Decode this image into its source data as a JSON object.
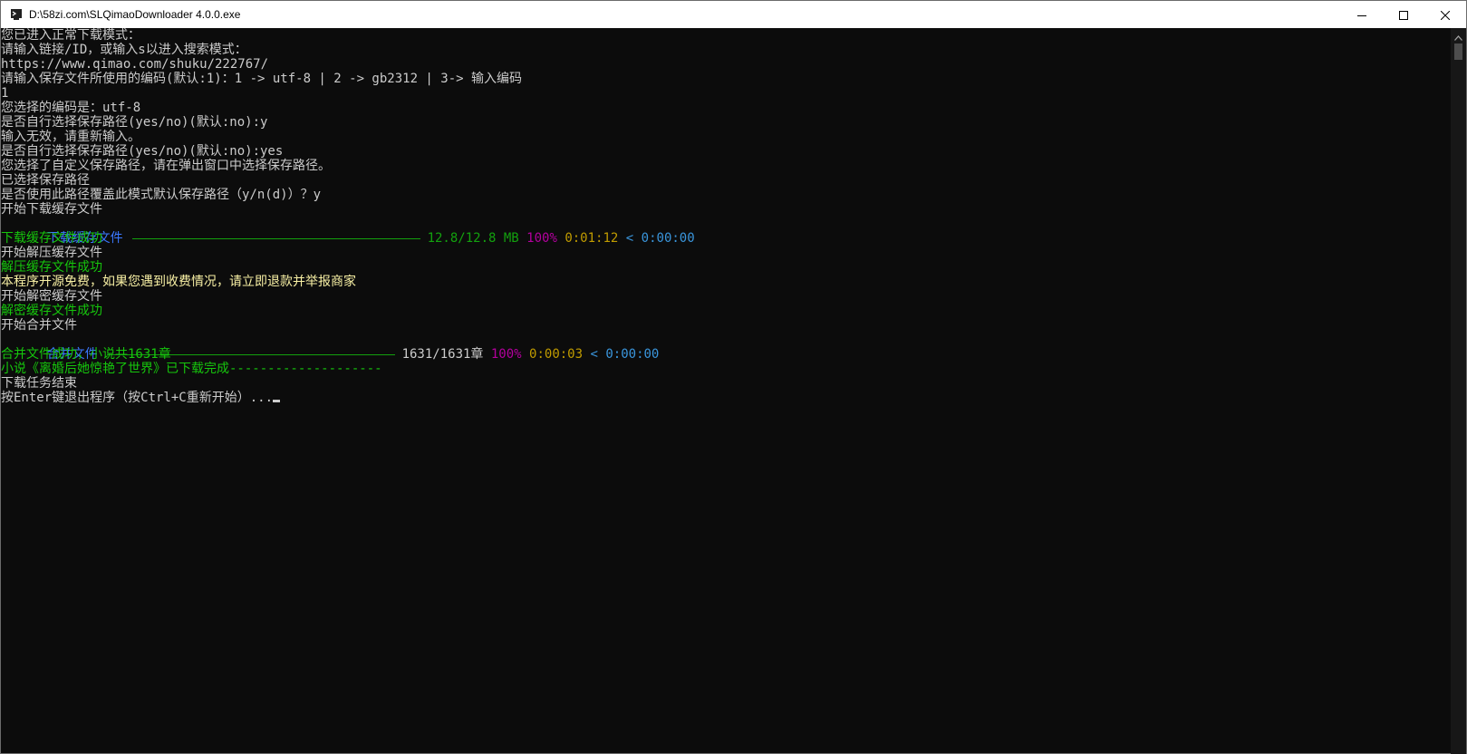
{
  "window": {
    "title": "D:\\58zi.com\\SLQimaoDownloader 4.0.0.exe",
    "icon": "terminal-app-icon",
    "controls": [
      "minimize-icon",
      "maximize-icon",
      "close-icon"
    ]
  },
  "console": {
    "lines": [
      "您已进入正常下载模式：",
      "请输入链接/ID，或输入s以进入搜索模式：",
      "https://www.qimao.com/shuku/222767/",
      "请输入保存文件所使用的编码(默认:1)：1 -> utf-8 | 2 -> gb2312 | 3-> 输入编码",
      "1",
      "您选择的编码是：utf-8",
      "是否自行选择保存路径(yes/no)(默认:no):y",
      "输入无效，请重新输入。",
      "是否自行选择保存路径(yes/no)(默认:no):yes",
      "您选择了自定义保存路径，请在弹出窗口中选择保存路径。",
      "已选择保存路径",
      "是否使用此路径覆盖此模式默认保存路径（y/n(d)）？y",
      "开始下载缓存文件"
    ],
    "progress1": {
      "label": "下载缓存文件",
      "size": "12.8/12.8 MB",
      "percent": "100%",
      "elapsed": "0:01:12",
      "sep": "<",
      "remaining": "0:00:00",
      "fraction": 1.0
    },
    "lines2": [
      {
        "text": "下载缓存文件成功",
        "color": "lg"
      },
      {
        "text": "开始解压缓存文件",
        "color": "w"
      },
      {
        "text": "解压缓存文件成功",
        "color": "lg"
      },
      {
        "text": "本程序开源免费，如果您遇到收费情况，请立即退款并举报商家",
        "color": "y"
      },
      {
        "text": "开始解密缓存文件",
        "color": "w"
      },
      {
        "text": "解密缓存文件成功",
        "color": "lg"
      },
      {
        "text": "开始合并文件",
        "color": "w"
      }
    ],
    "progress2": {
      "label": "合并文件",
      "count": "1631/1631章",
      "percent": "100%",
      "elapsed": "0:00:03",
      "sep": "<",
      "remaining": "0:00:00",
      "fraction": 1.0
    },
    "lines3": [
      {
        "text": "合并文件成功，小说共1631章",
        "color": "lg"
      },
      {
        "text": "小说《离婚后她惊艳了世界》已下载完成--------------------",
        "color": "lg"
      },
      {
        "text": "下载任务结束",
        "color": "w"
      }
    ],
    "prompt": "按Enter键退出程序（按Ctrl+C重新开始）..."
  }
}
